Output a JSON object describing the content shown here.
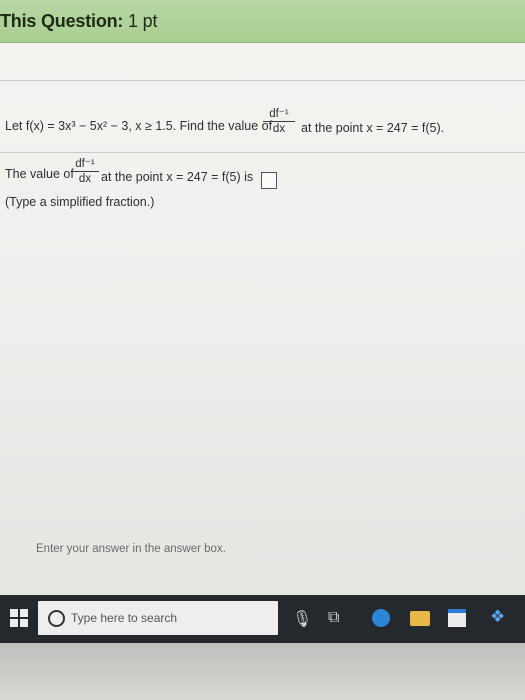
{
  "header": {
    "title": "This Question:",
    "points": "1 pt"
  },
  "question": {
    "text_before": "Let f(x) = 3x³ − 5x² − 3, x ≥ 1.5. Find the value of",
    "frac_num": "df⁻¹",
    "frac_den": "dx",
    "text_after": "at the point x = 247 = f(5)."
  },
  "answer": {
    "text_before": "The value of",
    "frac_num": "df⁻¹",
    "frac_den": "dx",
    "text_after": "at the point x = 247 = f(5) is",
    "hint": "(Type a simplified fraction.)"
  },
  "footer": {
    "instruction": "Enter your answer in the answer box."
  },
  "taskbar": {
    "search_placeholder": "Type here to search"
  }
}
